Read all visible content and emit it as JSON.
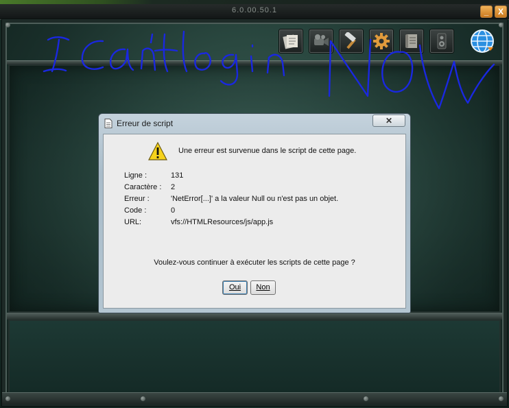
{
  "launcher": {
    "version": "6.0.00.50.1",
    "minimize_label": "_",
    "close_label": "X",
    "toolbar": [
      {
        "icon": "notes-icon"
      },
      {
        "icon": "video-camera-icon"
      },
      {
        "icon": "hammer-icon"
      },
      {
        "icon": "gear-icon"
      },
      {
        "icon": "scroll-icon"
      },
      {
        "icon": "speaker-icon"
      },
      {
        "icon": "globe-icon"
      }
    ],
    "overlay_scribble": "I can't login NOW"
  },
  "dialog": {
    "title": "Erreur de script",
    "close_label": "✕",
    "message": "Une erreur est survenue dans le script de cette page.",
    "fields": [
      {
        "label": "Ligne :",
        "value": "131"
      },
      {
        "label": "Caractère :",
        "value": "2"
      },
      {
        "label": "Erreur :",
        "value": "'NetError[...]' a la valeur Null ou n'est pas un objet."
      },
      {
        "label": "Code :",
        "value": "0"
      },
      {
        "label": "URL:",
        "value": "vfs://HTMLResources/js/app.js"
      }
    ],
    "question": "Voulez-vous continuer à exécuter les scripts de cette page ?",
    "yes_label": "Oui",
    "no_label": "Non"
  },
  "colors": {
    "scribble": "#1a28e0",
    "accent_orange": "#e09a3c"
  }
}
